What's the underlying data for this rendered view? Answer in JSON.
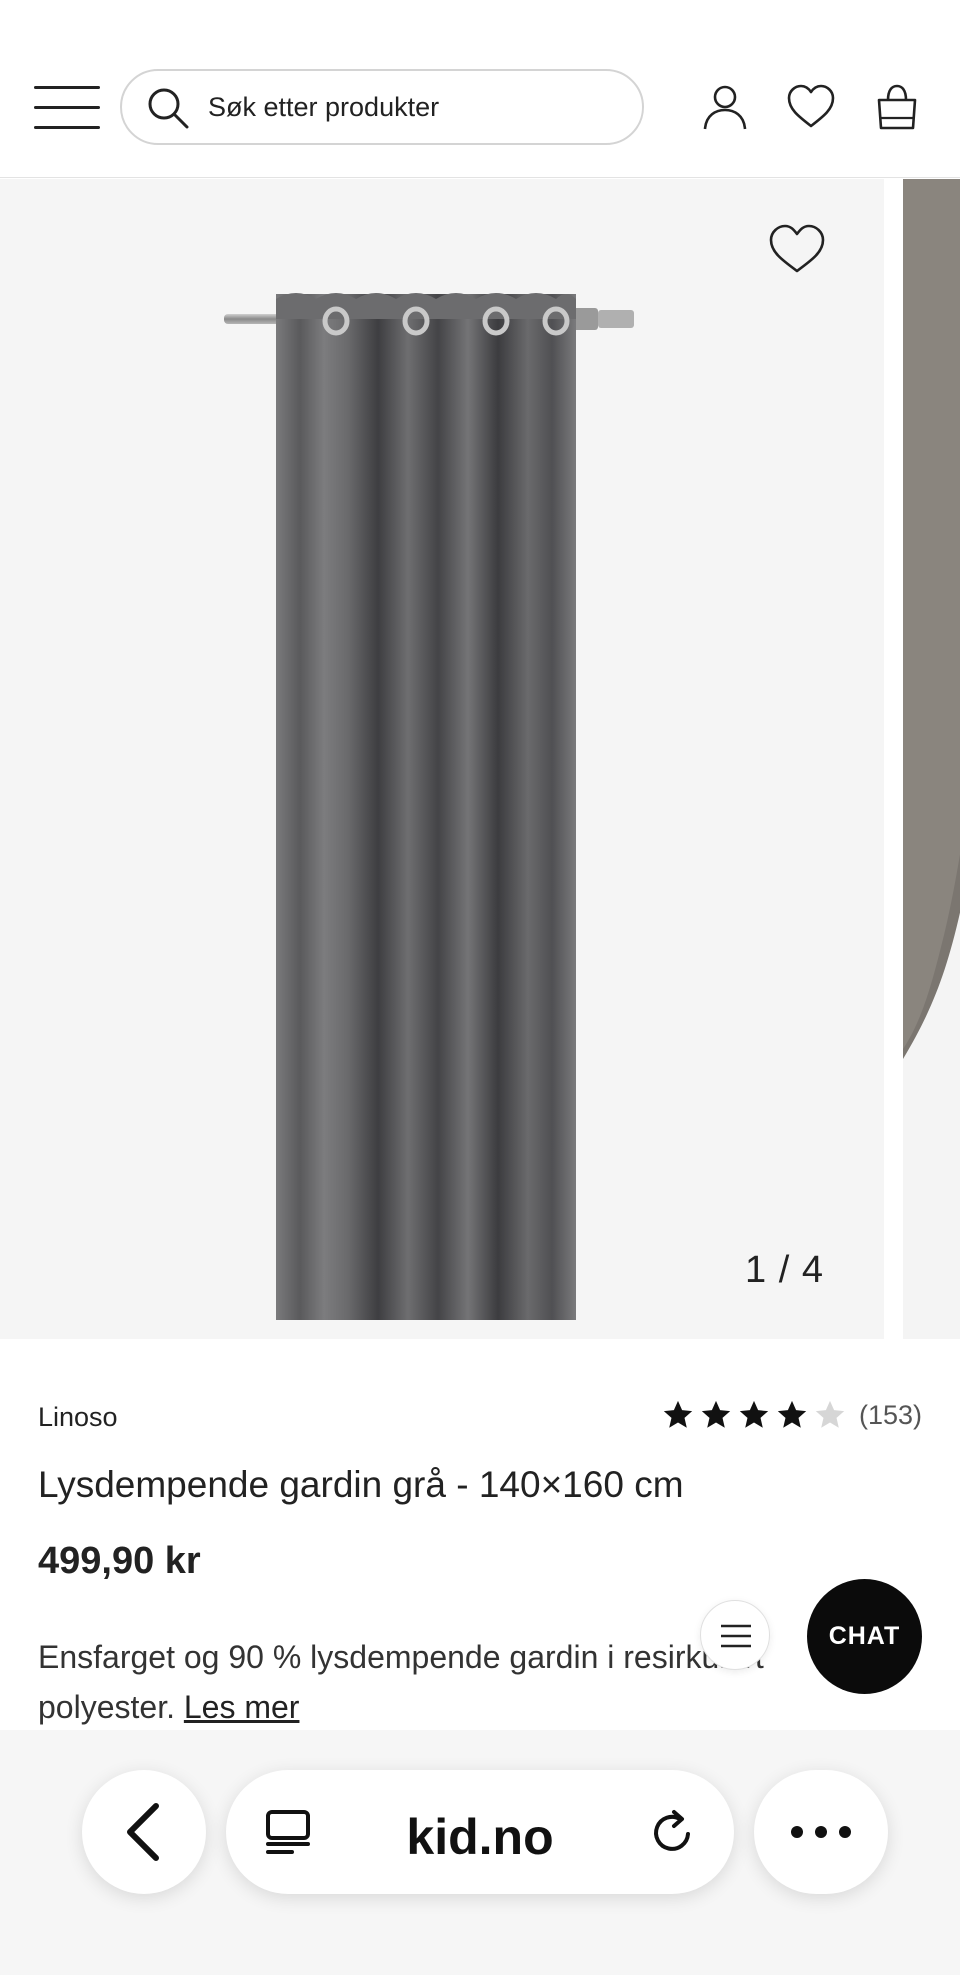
{
  "header": {
    "search_placeholder": "Søk etter produkter"
  },
  "gallery": {
    "counter": "1 / 4"
  },
  "product": {
    "brand": "Linoso",
    "rating": 4,
    "rating_max": 5,
    "review_count": "(153)",
    "title": "Lysdempende gardin grå - 140×160 cm",
    "price": "499,90 kr",
    "description_line1": "Ensfarget og 90 % lysdempende gardin i resirkulert",
    "description_line2": "polyester.",
    "read_more": "Les mer"
  },
  "floating": {
    "chat_label": "CHAT"
  },
  "browser": {
    "address": "kid.no"
  },
  "colors": {
    "star_filled": "#111111",
    "star_empty": "#d6d6d6",
    "chat_bg": "#0b0b0b",
    "curtain": "#6b6b6d"
  }
}
